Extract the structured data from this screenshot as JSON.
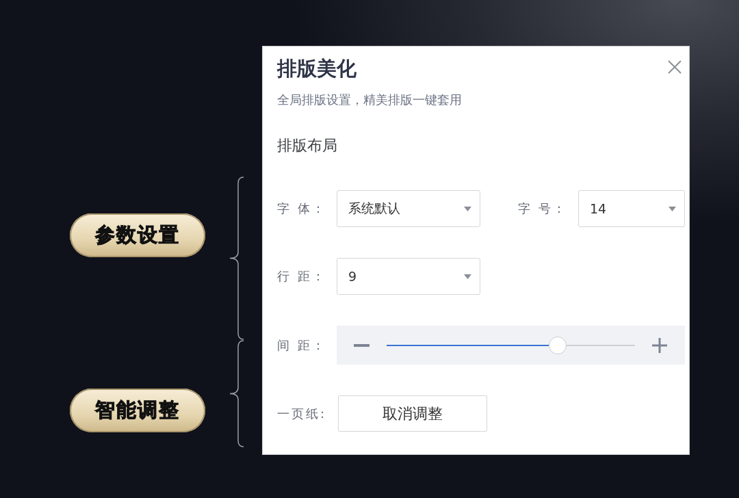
{
  "annotations": [
    {
      "label": "参数设置"
    },
    {
      "label": "智能调整"
    }
  ],
  "panel": {
    "title": "排版美化",
    "subtitle": "全局排版设置，精美排版一键套用",
    "section_title": "排版布局",
    "rows": [
      {
        "fields": [
          {
            "kind": "select",
            "label": "字 体：",
            "value": "系统默认"
          },
          {
            "kind": "select",
            "label": "字 号：",
            "value": "14"
          }
        ]
      },
      {
        "fields": [
          {
            "kind": "select",
            "label": "行 距：",
            "value": "9"
          }
        ]
      },
      {
        "fields": [
          {
            "kind": "slider",
            "label": "间 距：",
            "level": 0.69
          }
        ]
      },
      {
        "fields": [
          {
            "kind": "button",
            "label": "一页纸:",
            "text": "取消调整"
          }
        ]
      }
    ]
  }
}
